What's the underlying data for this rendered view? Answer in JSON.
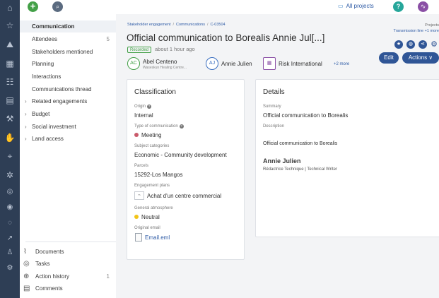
{
  "topbar": {
    "add_label": "+",
    "projects_label": "All projects"
  },
  "sidebar": {
    "items": [
      {
        "label": "Communication",
        "count": ""
      },
      {
        "label": "Attendees",
        "count": "5"
      },
      {
        "label": "Stakeholders mentioned",
        "count": ""
      },
      {
        "label": "Planning",
        "count": ""
      },
      {
        "label": "Interactions",
        "count": ""
      },
      {
        "label": "Communications thread",
        "count": ""
      },
      {
        "label": "Related engagements",
        "count": ""
      },
      {
        "label": "Budget",
        "count": ""
      },
      {
        "label": "Social investment",
        "count": ""
      },
      {
        "label": "Land access",
        "count": ""
      }
    ],
    "bottom_items": [
      {
        "label": "Documents",
        "count": ""
      },
      {
        "label": "Tasks",
        "count": ""
      },
      {
        "label": "Action history",
        "count": "1"
      },
      {
        "label": "Comments",
        "count": ""
      }
    ]
  },
  "header": {
    "breadcrumb": [
      "Stakeholder engagement",
      "Communications",
      "C-03504"
    ],
    "projects_label": "Projects",
    "projects_value": "Transmission line",
    "projects_more": "+1 more",
    "title": "Official communication to Borealis Annie Jul[...]",
    "badge": "Recorded",
    "time_ago": "about 1 hour ago",
    "edit_label": "Edit",
    "actions_label": "Actions",
    "actions_chevron": "∨"
  },
  "participants": [
    {
      "initials": "AC",
      "name": "Abel Centeno",
      "sub": "Waseskun Healing Centre..."
    },
    {
      "initials": "AJ",
      "name": "Annie Julien",
      "sub": ""
    },
    {
      "initials": "",
      "name": "Risk International",
      "sub": ""
    }
  ],
  "participants_more": "+2 more",
  "classification": {
    "title": "Classification",
    "origin_label": "Origin",
    "origin_value": "Internal",
    "type_label": "Type of communication",
    "type_value": "Meeting",
    "type_color": "#c95a6a",
    "subject_label": "Subject categories",
    "subject_value": "Economic - Community development",
    "parcels_label": "Parcels",
    "parcels_value": "15292-Los Mangos",
    "plans_label": "Engagement plans",
    "plans_value": "Achat d'un centre commercial",
    "atmosphere_label": "General atmosphere",
    "atmosphere_value": "Neutral",
    "atmosphere_color": "#f2c417",
    "email_label": "Original email",
    "email_value": "Email.eml"
  },
  "details": {
    "title": "Details",
    "summary_label": "Summary",
    "summary_value": "Official communication to Borealis",
    "description_label": "Description",
    "description_value": "Official communication to Borealis",
    "signature_name": "Annie Julien",
    "signature_role": "Rédactrice Technique | Technical Writer"
  },
  "colors": {
    "rail": "#2e3e55",
    "accent": "#2f5596",
    "success": "#43a047",
    "help": "#26a69a",
    "user": "#8a4fa5"
  }
}
